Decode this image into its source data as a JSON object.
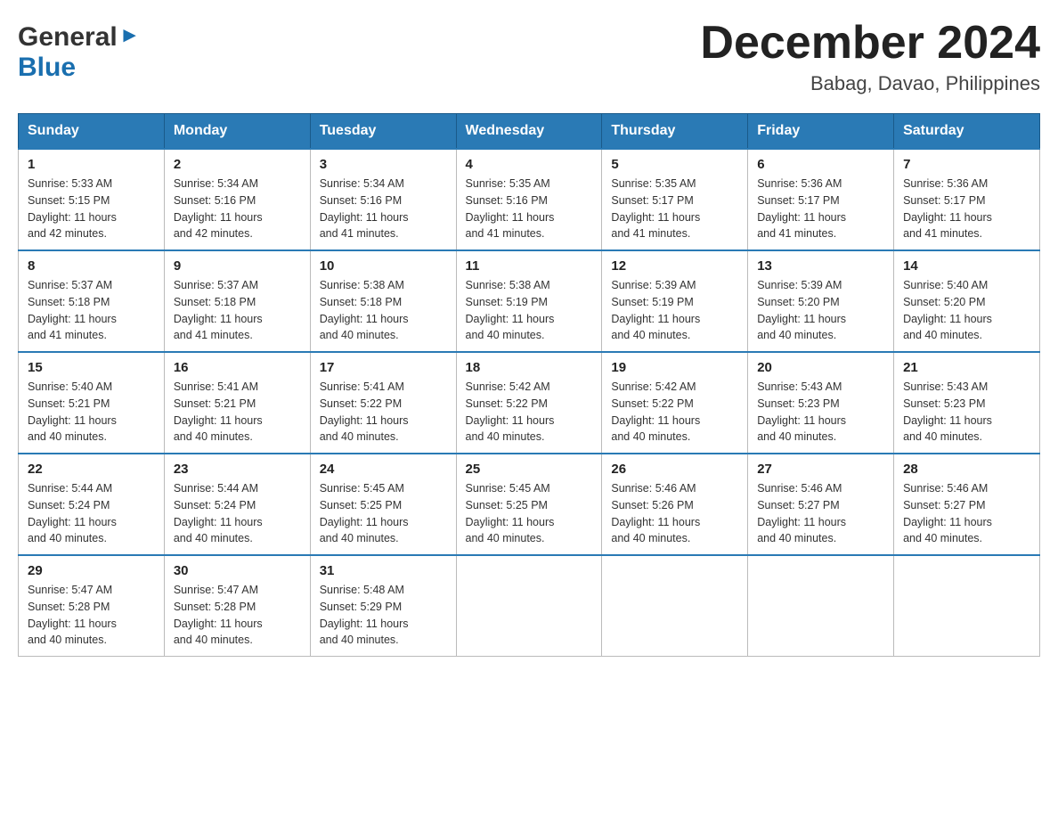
{
  "header": {
    "month_title": "December 2024",
    "location": "Babag, Davao, Philippines",
    "logo_general": "General",
    "logo_blue": "Blue"
  },
  "days_of_week": [
    "Sunday",
    "Monday",
    "Tuesday",
    "Wednesday",
    "Thursday",
    "Friday",
    "Saturday"
  ],
  "weeks": [
    [
      {
        "day": "1",
        "sunrise": "5:33 AM",
        "sunset": "5:15 PM",
        "daylight": "11 hours and 42 minutes."
      },
      {
        "day": "2",
        "sunrise": "5:34 AM",
        "sunset": "5:16 PM",
        "daylight": "11 hours and 42 minutes."
      },
      {
        "day": "3",
        "sunrise": "5:34 AM",
        "sunset": "5:16 PM",
        "daylight": "11 hours and 41 minutes."
      },
      {
        "day": "4",
        "sunrise": "5:35 AM",
        "sunset": "5:16 PM",
        "daylight": "11 hours and 41 minutes."
      },
      {
        "day": "5",
        "sunrise": "5:35 AM",
        "sunset": "5:17 PM",
        "daylight": "11 hours and 41 minutes."
      },
      {
        "day": "6",
        "sunrise": "5:36 AM",
        "sunset": "5:17 PM",
        "daylight": "11 hours and 41 minutes."
      },
      {
        "day": "7",
        "sunrise": "5:36 AM",
        "sunset": "5:17 PM",
        "daylight": "11 hours and 41 minutes."
      }
    ],
    [
      {
        "day": "8",
        "sunrise": "5:37 AM",
        "sunset": "5:18 PM",
        "daylight": "11 hours and 41 minutes."
      },
      {
        "day": "9",
        "sunrise": "5:37 AM",
        "sunset": "5:18 PM",
        "daylight": "11 hours and 41 minutes."
      },
      {
        "day": "10",
        "sunrise": "5:38 AM",
        "sunset": "5:18 PM",
        "daylight": "11 hours and 40 minutes."
      },
      {
        "day": "11",
        "sunrise": "5:38 AM",
        "sunset": "5:19 PM",
        "daylight": "11 hours and 40 minutes."
      },
      {
        "day": "12",
        "sunrise": "5:39 AM",
        "sunset": "5:19 PM",
        "daylight": "11 hours and 40 minutes."
      },
      {
        "day": "13",
        "sunrise": "5:39 AM",
        "sunset": "5:20 PM",
        "daylight": "11 hours and 40 minutes."
      },
      {
        "day": "14",
        "sunrise": "5:40 AM",
        "sunset": "5:20 PM",
        "daylight": "11 hours and 40 minutes."
      }
    ],
    [
      {
        "day": "15",
        "sunrise": "5:40 AM",
        "sunset": "5:21 PM",
        "daylight": "11 hours and 40 minutes."
      },
      {
        "day": "16",
        "sunrise": "5:41 AM",
        "sunset": "5:21 PM",
        "daylight": "11 hours and 40 minutes."
      },
      {
        "day": "17",
        "sunrise": "5:41 AM",
        "sunset": "5:22 PM",
        "daylight": "11 hours and 40 minutes."
      },
      {
        "day": "18",
        "sunrise": "5:42 AM",
        "sunset": "5:22 PM",
        "daylight": "11 hours and 40 minutes."
      },
      {
        "day": "19",
        "sunrise": "5:42 AM",
        "sunset": "5:22 PM",
        "daylight": "11 hours and 40 minutes."
      },
      {
        "day": "20",
        "sunrise": "5:43 AM",
        "sunset": "5:23 PM",
        "daylight": "11 hours and 40 minutes."
      },
      {
        "day": "21",
        "sunrise": "5:43 AM",
        "sunset": "5:23 PM",
        "daylight": "11 hours and 40 minutes."
      }
    ],
    [
      {
        "day": "22",
        "sunrise": "5:44 AM",
        "sunset": "5:24 PM",
        "daylight": "11 hours and 40 minutes."
      },
      {
        "day": "23",
        "sunrise": "5:44 AM",
        "sunset": "5:24 PM",
        "daylight": "11 hours and 40 minutes."
      },
      {
        "day": "24",
        "sunrise": "5:45 AM",
        "sunset": "5:25 PM",
        "daylight": "11 hours and 40 minutes."
      },
      {
        "day": "25",
        "sunrise": "5:45 AM",
        "sunset": "5:25 PM",
        "daylight": "11 hours and 40 minutes."
      },
      {
        "day": "26",
        "sunrise": "5:46 AM",
        "sunset": "5:26 PM",
        "daylight": "11 hours and 40 minutes."
      },
      {
        "day": "27",
        "sunrise": "5:46 AM",
        "sunset": "5:27 PM",
        "daylight": "11 hours and 40 minutes."
      },
      {
        "day": "28",
        "sunrise": "5:46 AM",
        "sunset": "5:27 PM",
        "daylight": "11 hours and 40 minutes."
      }
    ],
    [
      {
        "day": "29",
        "sunrise": "5:47 AM",
        "sunset": "5:28 PM",
        "daylight": "11 hours and 40 minutes."
      },
      {
        "day": "30",
        "sunrise": "5:47 AM",
        "sunset": "5:28 PM",
        "daylight": "11 hours and 40 minutes."
      },
      {
        "day": "31",
        "sunrise": "5:48 AM",
        "sunset": "5:29 PM",
        "daylight": "11 hours and 40 minutes."
      },
      null,
      null,
      null,
      null
    ]
  ],
  "labels": {
    "sunrise": "Sunrise:",
    "sunset": "Sunset:",
    "daylight": "Daylight:"
  }
}
